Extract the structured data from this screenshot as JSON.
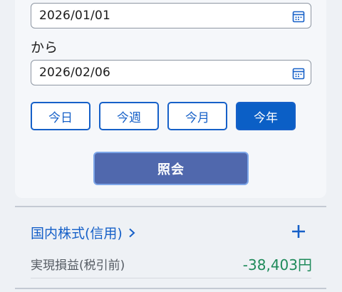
{
  "filter": {
    "start_date": "2026/01/01",
    "separator": "から",
    "end_date": "2026/02/06",
    "ranges": [
      {
        "label": "今日",
        "active": false
      },
      {
        "label": "今週",
        "active": false
      },
      {
        "label": "今月",
        "active": false
      },
      {
        "label": "今年",
        "active": true
      }
    ],
    "search_label": "照会"
  },
  "section": {
    "title": "国内株式(信用)",
    "realized_pl_label": "実現損益(税引前)",
    "realized_pl_value": "-38,403円"
  },
  "colors": {
    "accent": "#1660c8",
    "search_button": "#5068ad",
    "positive_value": "#1e8a5a"
  },
  "icons": [
    "calendar-icon",
    "chevron-right-icon",
    "plus-icon"
  ]
}
